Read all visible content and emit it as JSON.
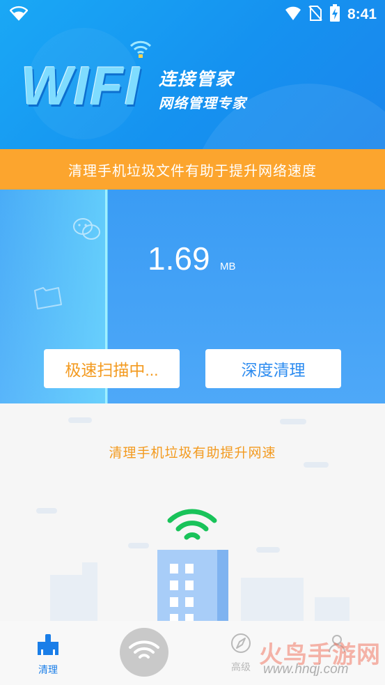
{
  "status_bar": {
    "time": "8:41",
    "icons": [
      "wifi-icon",
      "signal-icon",
      "no-sim-icon",
      "battery-charging-icon"
    ]
  },
  "header": {
    "logo_wifi": "WIFI",
    "logo_title": "连接管家",
    "logo_subtitle": "网络管理专家"
  },
  "banner": {
    "text": "清理手机垃圾文件有助于提升网络速度"
  },
  "scan": {
    "size_value": "1.69",
    "size_unit": "MB",
    "fast_scan_label": "极速扫描中...",
    "deep_clean_label": "深度清理"
  },
  "illustration": {
    "tip": "清理手机垃圾有助提升网速"
  },
  "bottom_nav": {
    "items": [
      {
        "label": "清理",
        "icon": "broom-icon",
        "active": true
      },
      {
        "label": "",
        "icon": "wifi-icon",
        "active": false
      },
      {
        "label": "高级",
        "icon": "compass-icon",
        "active": false
      },
      {
        "label": "",
        "icon": "user-icon",
        "active": false
      }
    ]
  },
  "watermark": {
    "text": "火鸟手游网",
    "url": "www.hnqj.com"
  },
  "colors": {
    "primary": "#1a92f0",
    "accent_orange": "#fca52e",
    "tip_orange": "#f39a1f",
    "green_signal": "#19c35a"
  }
}
